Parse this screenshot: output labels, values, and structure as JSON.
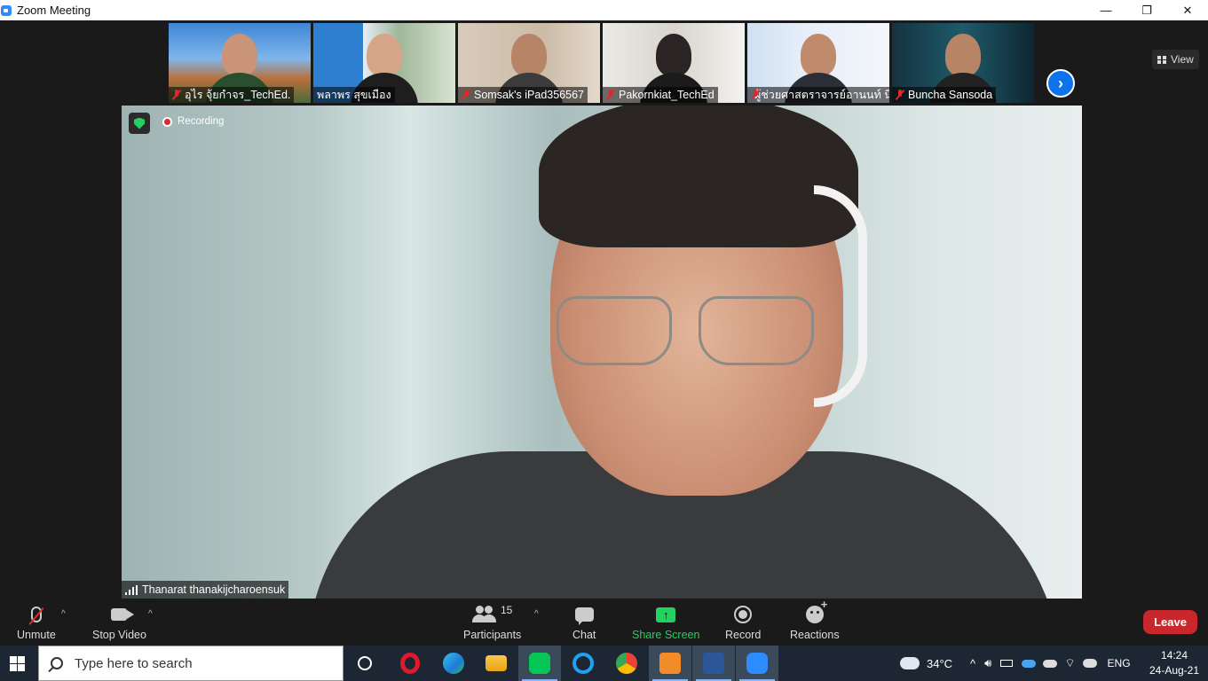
{
  "window": {
    "title": "Zoom Meeting",
    "minimize": "—",
    "restore": "❐",
    "close": "✕"
  },
  "gallery": {
    "participants": [
      {
        "name": "อุไร จุ้ยกำจร_TechEd.",
        "muted": true
      },
      {
        "name": "พลาพร สุขเมือง",
        "muted": false
      },
      {
        "name": "Somsak's iPad356567",
        "muted": true
      },
      {
        "name": "Pakornkiat_TechEd",
        "muted": true
      },
      {
        "name": "ผู้ช่วยศาสตราจารย์อานนท์ นิ...",
        "muted": true
      },
      {
        "name": "Buncha Sansoda",
        "muted": true
      }
    ],
    "next_icon": "›",
    "view_label": "View"
  },
  "main_video": {
    "recording_label": "Recording",
    "speaker_name": "Thanarat thanakijcharoensuk"
  },
  "toolbar": {
    "unmute_label": "Unmute",
    "stop_video_label": "Stop Video",
    "participants_label": "Participants",
    "participants_count": "15",
    "chat_label": "Chat",
    "share_screen_label": "Share Screen",
    "share_icon": "↑",
    "record_label": "Record",
    "reactions_label": "Reactions",
    "leave_label": "Leave",
    "caret": "^"
  },
  "taskbar": {
    "search_placeholder": "Type here to search",
    "weather_temp": "34°C",
    "language": "ENG",
    "time": "14:24",
    "date": "24-Aug-21",
    "tray_caret": "^"
  },
  "colors": {
    "accent_blue": "#0e72ed",
    "share_green": "#23d160",
    "leave_red": "#c8282b",
    "muted_red": "#e02828"
  }
}
